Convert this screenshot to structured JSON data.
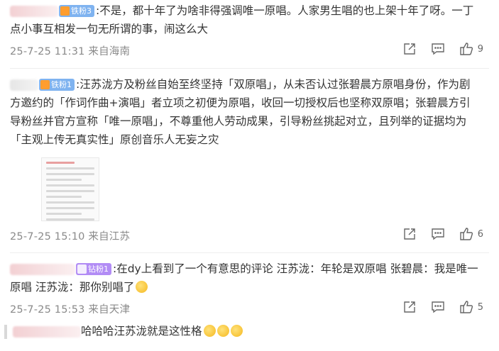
{
  "comments": [
    {
      "badge": "铁粉3",
      "lines": [
        ":不是，都十年了为啥非得强调唯一原唱。人家男生唱的也上架十年了呀。一丁",
        "点小事互相发一句无所谓的事，闹这么大"
      ],
      "meta": "25-7-25 11:31 来自海南",
      "likes": "9"
    },
    {
      "badge": "铁粉1",
      "lines": [
        ":汪苏泷方及粉丝自始至终坚持「双原唱」，从未否认过张碧晨方原唱身份，作为剧",
        "方邀约的「作词作曲+演唱」者立项之初便为原唱，收回一切授权后也坚称双原唱；张碧晨方引",
        "导粉丝并官方宣称「唯一原唱」，不尊重他人劳动成果，引导粉丝挑起对立，且列举的证据均为",
        "「主观上传无真实性」原创音乐人无妄之灾"
      ],
      "meta": "25-7-25 15:10 来自江苏",
      "likes": "6"
    },
    {
      "badge": "钻粉1",
      "lines": [
        ":在dy上看到了一个有意思的评论 汪苏泷：年轮是双原唱 张碧晨：我是唯一",
        "原唱 汪苏泷：那你别唱了"
      ],
      "meta": "25-7-25 15:53 来自天津",
      "likes": "5"
    }
  ],
  "reply": {
    "text": "哈哈哈汪苏泷就是这性格"
  },
  "icons": {
    "share": "share-icon",
    "comment": "comment-icon",
    "like": "thumbs-up-icon"
  },
  "colors": {
    "badge_blue": "#7fb3f0",
    "badge_purple": "#b28cf5",
    "meta": "#8a8a8a"
  }
}
